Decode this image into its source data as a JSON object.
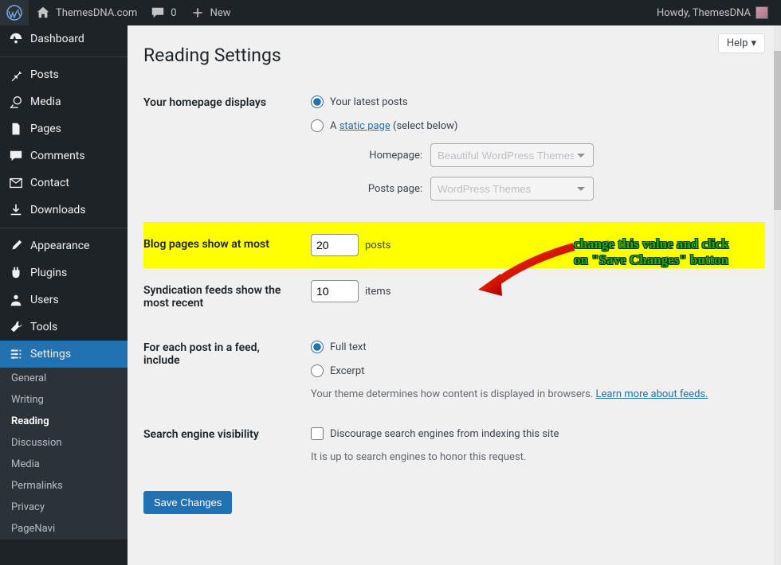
{
  "adminbar": {
    "site_name": "ThemesDNA.com",
    "comments_count": "0",
    "new_label": "New",
    "howdy": "Howdy, ThemesDNA"
  },
  "sidebar": {
    "items": [
      {
        "label": "Dashboard"
      },
      {
        "label": "Posts"
      },
      {
        "label": "Media"
      },
      {
        "label": "Pages"
      },
      {
        "label": "Comments"
      },
      {
        "label": "Contact"
      },
      {
        "label": "Downloads"
      },
      {
        "label": "Appearance"
      },
      {
        "label": "Plugins"
      },
      {
        "label": "Users"
      },
      {
        "label": "Tools"
      },
      {
        "label": "Settings"
      }
    ],
    "submenu": [
      {
        "label": "General"
      },
      {
        "label": "Writing"
      },
      {
        "label": "Reading"
      },
      {
        "label": "Discussion"
      },
      {
        "label": "Media"
      },
      {
        "label": "Permalinks"
      },
      {
        "label": "Privacy"
      },
      {
        "label": "PageNavi"
      }
    ]
  },
  "help_label": "Help",
  "page_title": "Reading Settings",
  "homepage": {
    "th": "Your homepage displays",
    "opt_latest": "Your latest posts",
    "opt_static_prefix": "A ",
    "opt_static_link": "static page",
    "opt_static_suffix": " (select below)",
    "homepage_label": "Homepage:",
    "homepage_select": "Beautiful WordPress Themes",
    "postspage_label": "Posts page:",
    "postspage_select": "WordPress Themes"
  },
  "blogpages": {
    "th": "Blog pages show at most",
    "value": "20",
    "suffix": "posts"
  },
  "feeds": {
    "th": "Syndication feeds show the most recent",
    "value": "10",
    "suffix": "items"
  },
  "feedcontent": {
    "th": "For each post in a feed, include",
    "opt_full": "Full text",
    "opt_excerpt": "Excerpt",
    "hint_prefix": "Your theme determines how content is displayed in browsers. ",
    "hint_link": "Learn more about feeds.",
    "hint_suffix": ""
  },
  "searchvis": {
    "th": "Search engine visibility",
    "checkbox_label": "Discourage search engines from indexing this site",
    "hint": "It is up to search engines to honor this request."
  },
  "save_button": "Save Changes",
  "annotation": {
    "line1": "change this value and click",
    "line2": "on \"Save Changes\" button"
  }
}
